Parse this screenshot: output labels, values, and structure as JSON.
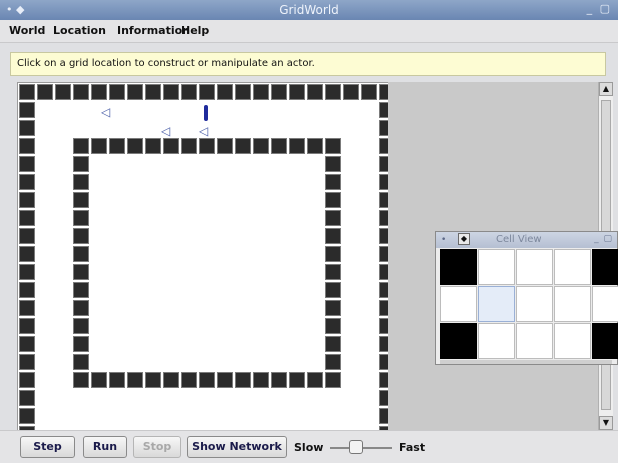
{
  "window": {
    "title": "GridWorld"
  },
  "menu": {
    "world": "World",
    "location": "Location",
    "information": "Information",
    "help": "Help"
  },
  "message": "Click on a grid location to construct or manipulate an actor.",
  "toolbar": {
    "step": "Step",
    "run": "Run",
    "stop": "Stop",
    "show_network": "Show Network",
    "slow": "Slow",
    "fast": "Fast",
    "speed_level": 0.4
  },
  "cell_view": {
    "title": "Cell View"
  },
  "icons": {
    "bug": "bug-icon",
    "flower": "flower-icon",
    "rock": "rock-tile"
  },
  "colors": {
    "titlebar": "#7690bb",
    "message_bg": "#fdfcd3",
    "rock": "#2b2b2b",
    "flower": "#1f2b9c",
    "bug": "#4a5ea8"
  }
}
